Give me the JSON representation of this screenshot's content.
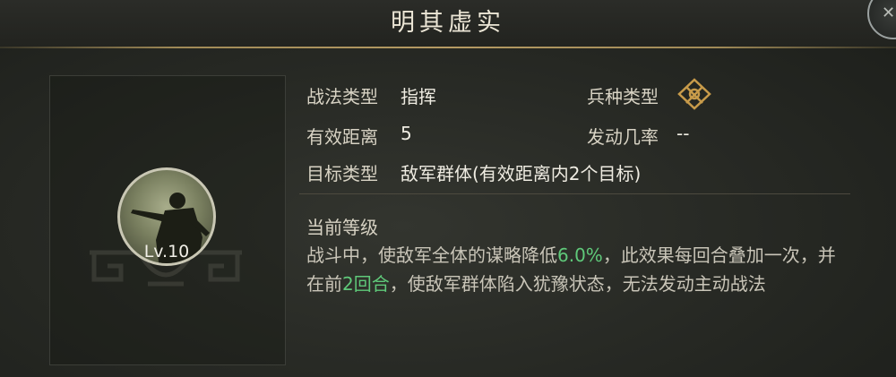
{
  "dialog": {
    "title": "明其虚实"
  },
  "skill": {
    "level": "Lv.10"
  },
  "info": {
    "type_label": "战法类型",
    "type_value": "指挥",
    "troop_label": "兵种类型",
    "range_label": "有效距离",
    "range_value": "5",
    "rate_label": "发动几率",
    "rate_value": "--",
    "target_label": "目标类型",
    "target_value": "敌军群体(有效距离内2个目标)"
  },
  "current": {
    "label": "当前等级",
    "desc_1": "战斗中，使敌军全体的谋略降低",
    "pct": "6.0%",
    "desc_2": "，此效果每回合叠加一次，并在前",
    "turns": "2回合",
    "desc_3": "，使敌军群体陷入犹豫状态，无法发动主动战法"
  },
  "colors": {
    "accent_gold": "#c89b4a",
    "highlight_green": "#5fc97a"
  },
  "icons": {
    "troop": "troop-type-icon",
    "close": "close-icon",
    "skill": "skill-portrait"
  }
}
